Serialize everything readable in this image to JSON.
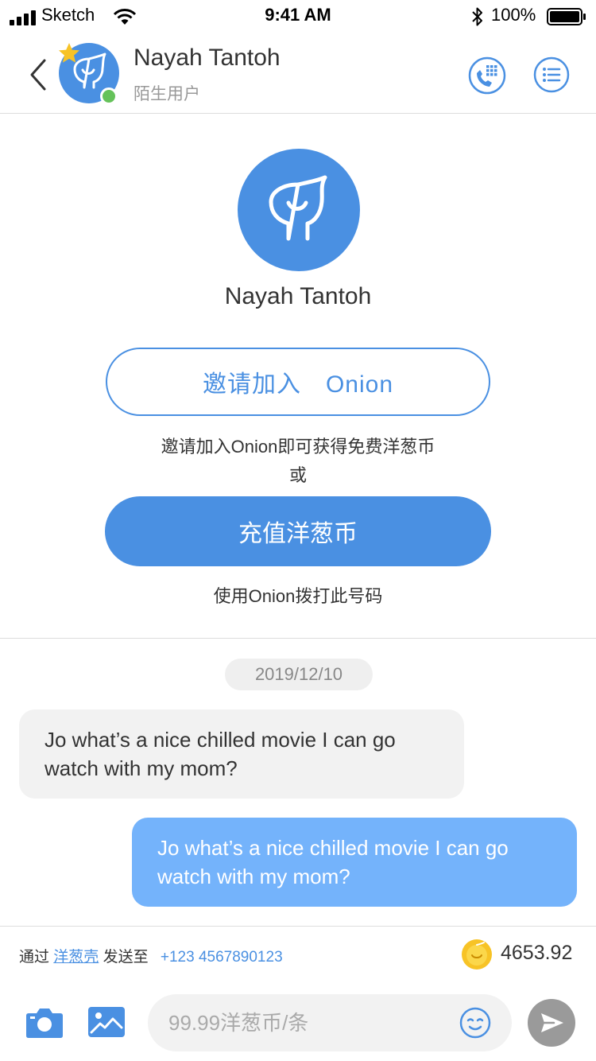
{
  "status_bar": {
    "carrier": "Sketch",
    "time": "9:41 AM",
    "battery": "100%"
  },
  "header": {
    "contact_name": "Nayah Tantoh",
    "contact_subtitle": "陌生用户"
  },
  "profile": {
    "name": "Nayah Tantoh",
    "invite_button": "邀请加入　Onion",
    "invite_hint": "邀请加入Onion即可获得免费洋葱币",
    "or_text": "或",
    "recharge_button": "充值洋葱币",
    "dial_hint": "使用Onion拨打此号码"
  },
  "chat": {
    "date": "2019/12/10",
    "messages": [
      {
        "direction": "incoming",
        "text": "Jo what’s a nice chilled movie I can go watch with my mom?"
      },
      {
        "direction": "outgoing",
        "text": "Jo what’s a nice chilled movie I can go watch with my mom?"
      }
    ]
  },
  "send_bar": {
    "via_prefix": "通过",
    "via_service": "洋葱壳",
    "via_send_to": "发送至",
    "phone_number": "+123 4567890123",
    "balance": "4653.92",
    "input_placeholder": "99.99洋葱币/条",
    "input_value": ""
  },
  "colors": {
    "accent": "#4a90e2",
    "outgoing_bubble": "#74b3fb",
    "incoming_bubble": "#f2f2f2",
    "online": "#65c25a",
    "coin": "#f7c326",
    "send_disabled": "#9a9a9a"
  },
  "icons": [
    "signal-icon",
    "wifi-icon",
    "bluetooth-icon",
    "battery-icon",
    "back-icon",
    "star-icon",
    "phone-dialpad-icon",
    "list-menu-icon",
    "onion-avatar-icon",
    "coin-icon",
    "camera-icon",
    "image-icon",
    "emoji-icon",
    "send-icon"
  ]
}
